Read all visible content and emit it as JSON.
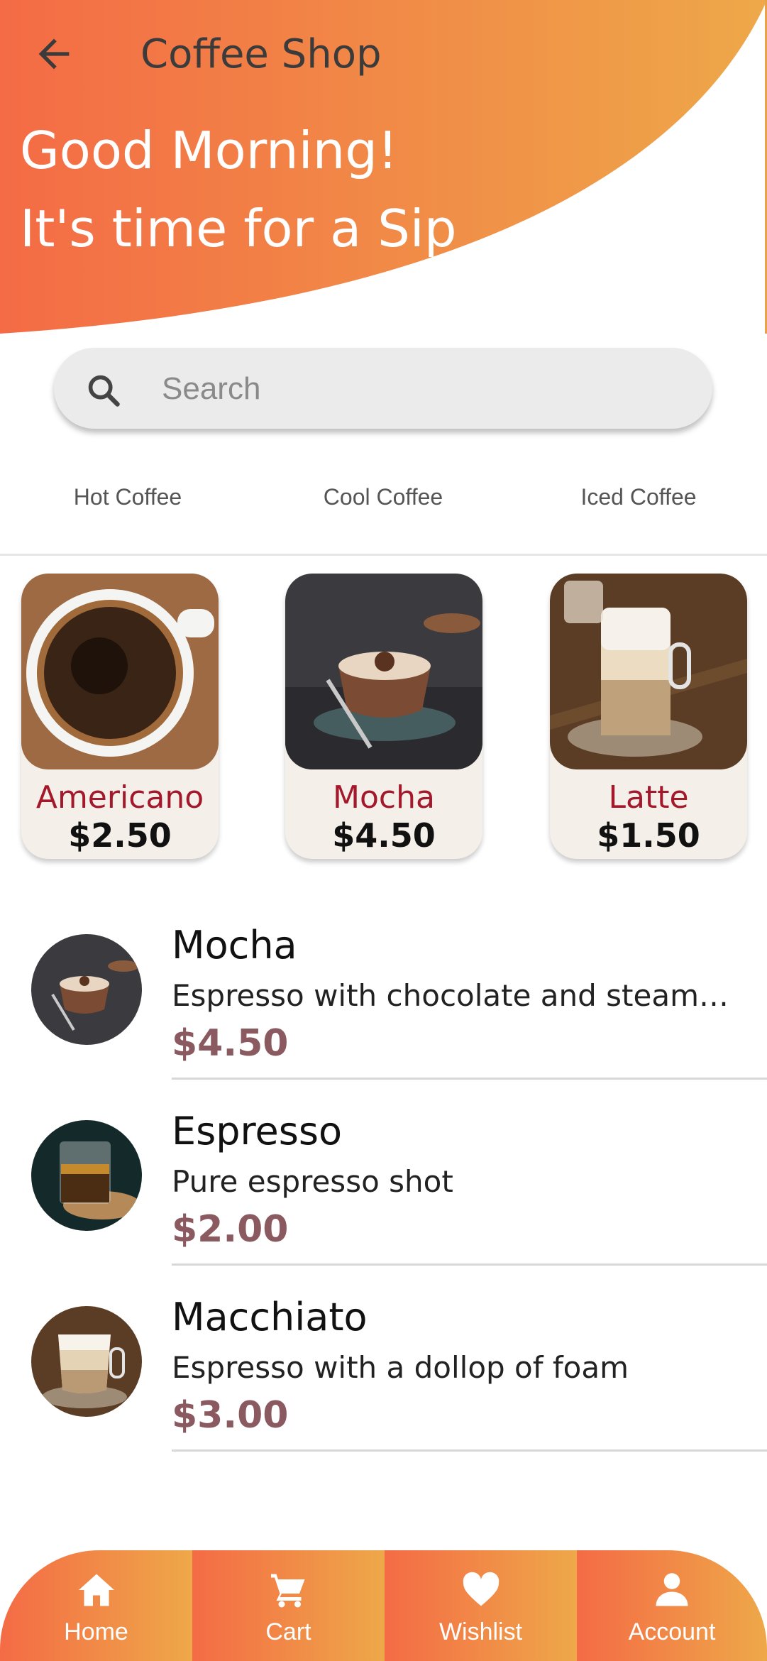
{
  "header": {
    "title": "Coffee Shop",
    "greeting_line1": "Good Morning!",
    "greeting_line2": "It's time for a Sip",
    "back_icon": "arrow-left-icon"
  },
  "search": {
    "placeholder": "Search",
    "icon": "search-icon"
  },
  "tabs": [
    {
      "label": "Hot Coffee"
    },
    {
      "label": "Cool Coffee"
    },
    {
      "label": "Iced Coffee"
    }
  ],
  "featured": [
    {
      "name": "Americano",
      "price": "$2.50"
    },
    {
      "name": "Mocha",
      "price": "$4.50"
    },
    {
      "name": "Latte",
      "price": "$1.50"
    }
  ],
  "menu": [
    {
      "name": "Mocha",
      "description": "Espresso with chocolate and steamed ...",
      "price": "$4.50"
    },
    {
      "name": "Espresso",
      "description": "Pure espresso shot",
      "price": "$2.00"
    },
    {
      "name": "Macchiato",
      "description": "Espresso with a dollop of foam",
      "price": "$3.00"
    }
  ],
  "bottom_nav": [
    {
      "label": "Home",
      "icon": "home-icon"
    },
    {
      "label": "Cart",
      "icon": "cart-icon"
    },
    {
      "label": "Wishlist",
      "icon": "heart-icon"
    },
    {
      "label": "Account",
      "icon": "account-icon"
    }
  ],
  "colors": {
    "gradient_start": "#f46b45",
    "gradient_end": "#eea849",
    "card_name": "#a3182a",
    "list_price": "#8a5a60"
  }
}
